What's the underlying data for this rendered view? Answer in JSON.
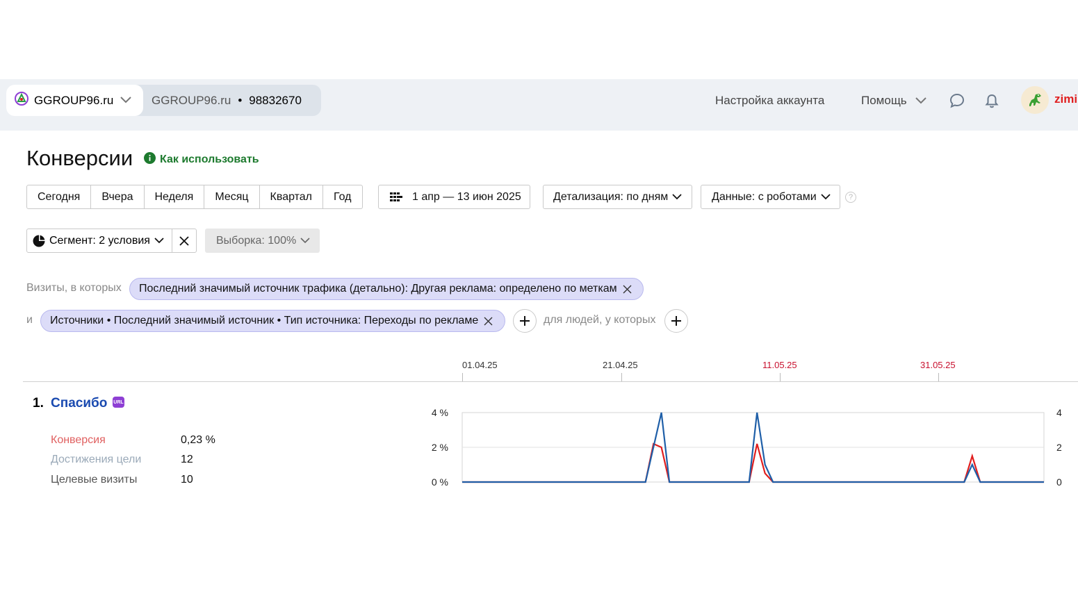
{
  "header": {
    "site_name": "GGROUP96.ru",
    "counter_name": "GGROUP96.ru",
    "counter_separator": "•",
    "counter_id": "98832670",
    "account_settings": "Настройка аккаунта",
    "help": "Помощь",
    "username": "zimi"
  },
  "page": {
    "title": "Конверсии",
    "howto": "Как использовать"
  },
  "periods": [
    "Сегодня",
    "Вчера",
    "Неделя",
    "Месяц",
    "Квартал",
    "Год"
  ],
  "date_range": "1 апр — 13 июн 2025",
  "detail": "Детализация: по дням",
  "data_mode": "Данные: с роботами",
  "help_glyph": "?",
  "segment": {
    "label": "Сегмент: 2 условия",
    "sample": "Выборка: 100%",
    "visits_prefix": "Визиты, в которых",
    "condition1": "Последний значимый источник трафика (детально): Другая реклама: определено по меткам",
    "and_label": "и",
    "condition2": "Источники • Последний значимый источник • Тип источника: Переходы по рекламе",
    "people_label": "для людей, у которых"
  },
  "timeline": {
    "dates": [
      "01.04.25",
      "21.04.25",
      "11.05.25",
      "31.05.25"
    ],
    "red_dates": [
      false,
      false,
      true,
      true
    ]
  },
  "goal": {
    "number": "1.",
    "name": "Спасибо",
    "badge": "URL",
    "metrics": [
      {
        "label": "Конверсия",
        "value": "0,23 %",
        "color": "#e06060"
      },
      {
        "label": "Достижения цели",
        "value": "12",
        "color": "#9aa9b8"
      },
      {
        "label": "Целевые визиты",
        "value": "10",
        "color": "#555555"
      }
    ]
  },
  "chart_data": {
    "type": "line",
    "x_start": "2025-04-01",
    "x_end": "2025-06-13",
    "y_left_ticks": [
      "4 %",
      "2 %",
      "0 %"
    ],
    "y_right_ticks": [
      "4",
      "2",
      "0"
    ],
    "ylim": [
      0,
      4
    ],
    "grid": true,
    "series": [
      {
        "color": "#e01e1e",
        "points": [
          {
            "x": "2025-04-01",
            "y": 0
          },
          {
            "x": "2025-04-24",
            "y": 0
          },
          {
            "x": "2025-04-25",
            "y": 2.2
          },
          {
            "x": "2025-04-26",
            "y": 2.0
          },
          {
            "x": "2025-04-27",
            "y": 0
          },
          {
            "x": "2025-05-07",
            "y": 0
          },
          {
            "x": "2025-05-08",
            "y": 2.2
          },
          {
            "x": "2025-05-09",
            "y": 0.5
          },
          {
            "x": "2025-05-10",
            "y": 0
          },
          {
            "x": "2025-06-03",
            "y": 0
          },
          {
            "x": "2025-06-04",
            "y": 1.5
          },
          {
            "x": "2025-06-05",
            "y": 0
          },
          {
            "x": "2025-06-13",
            "y": 0
          }
        ]
      },
      {
        "color": "#1f5fa8",
        "points": [
          {
            "x": "2025-04-01",
            "y": 0
          },
          {
            "x": "2025-04-24",
            "y": 0
          },
          {
            "x": "2025-04-26",
            "y": 4
          },
          {
            "x": "2025-04-27",
            "y": 0
          },
          {
            "x": "2025-05-07",
            "y": 0
          },
          {
            "x": "2025-05-08",
            "y": 4
          },
          {
            "x": "2025-05-09",
            "y": 1
          },
          {
            "x": "2025-05-10",
            "y": 0
          },
          {
            "x": "2025-06-03",
            "y": 0
          },
          {
            "x": "2025-06-04",
            "y": 1
          },
          {
            "x": "2025-06-05",
            "y": 0
          },
          {
            "x": "2025-06-13",
            "y": 0
          }
        ]
      }
    ]
  },
  "icons": {
    "site": "site-logo-icon",
    "chat": "chat-icon",
    "bell": "bell-icon",
    "calendar": "calendar-grid-icon",
    "segment": "pie-segment-icon",
    "info": "info-icon"
  },
  "colors": {
    "accent_green": "#1d7a2e",
    "goal_link": "#1a4ab0",
    "chip": "#dcdcf8",
    "red_date": "#c8102e"
  }
}
